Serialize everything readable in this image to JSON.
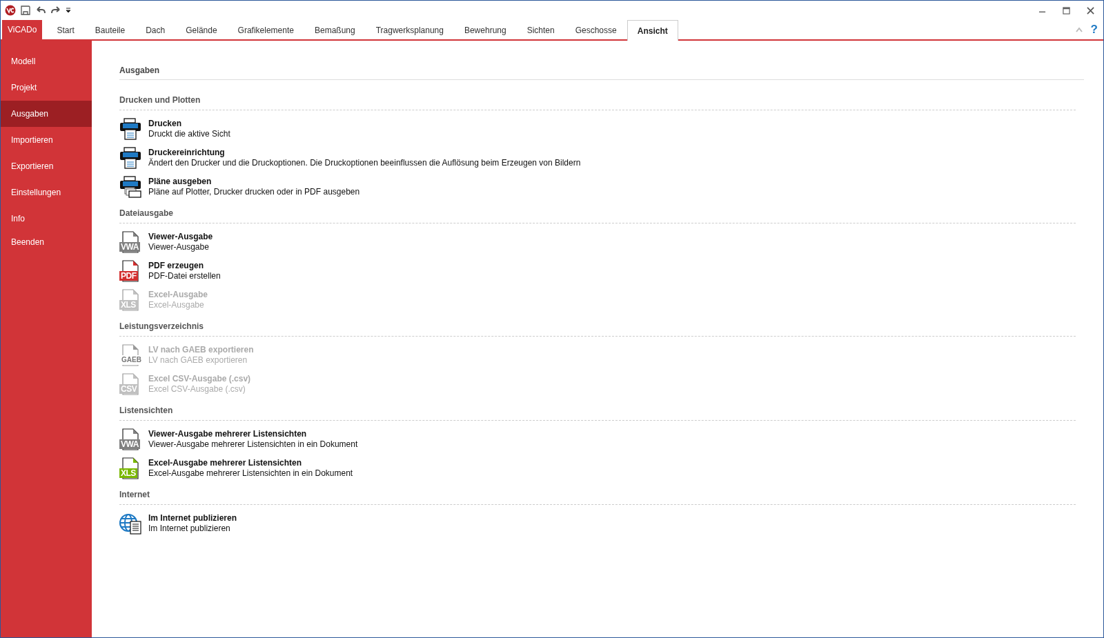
{
  "tabs": [
    {
      "label": "ViCADo",
      "kind": "app",
      "selected": false
    },
    {
      "label": "Start",
      "kind": "tab",
      "selected": false
    },
    {
      "label": "Bauteile",
      "kind": "tab",
      "selected": false
    },
    {
      "label": "Dach",
      "kind": "tab",
      "selected": false
    },
    {
      "label": "Gelände",
      "kind": "tab",
      "selected": false
    },
    {
      "label": "Grafikelemente",
      "kind": "tab",
      "selected": false
    },
    {
      "label": "Bemaßung",
      "kind": "tab",
      "selected": false
    },
    {
      "label": "Tragwerksplanung",
      "kind": "tab",
      "selected": false
    },
    {
      "label": "Bewehrung",
      "kind": "tab",
      "selected": false
    },
    {
      "label": "Sichten",
      "kind": "tab",
      "selected": false
    },
    {
      "label": "Geschosse",
      "kind": "tab",
      "selected": false
    },
    {
      "label": "Ansicht",
      "kind": "tab",
      "selected": true
    }
  ],
  "help": "?",
  "sidebar": {
    "items": [
      {
        "label": "Modell",
        "selected": false
      },
      {
        "label": "Projekt",
        "selected": false
      },
      {
        "label": "Ausgaben",
        "selected": true
      },
      {
        "label": "Importieren",
        "selected": false
      },
      {
        "label": "Exportieren",
        "selected": false
      },
      {
        "label": "Einstellungen",
        "selected": false
      },
      {
        "label": "Info",
        "selected": false
      },
      {
        "label": "Beenden",
        "selected": false
      }
    ]
  },
  "title": "Ausgaben",
  "sections": [
    {
      "heading": "Drucken und Plotten",
      "items": [
        {
          "kind": "printer",
          "title": "Drucken",
          "description": "Druckt die aktive Sicht",
          "disabled": false
        },
        {
          "kind": "printer",
          "title": "Druckereinrichtung",
          "description": "Ändert den Drucker und die Druckoptionen. Die Druckoptionen beeinflussen die Auflösung beim Erzeugen von Bildern",
          "disabled": false
        },
        {
          "kind": "printer-stack",
          "title": "Pläne ausgeben",
          "description": "Pläne auf Plotter, Drucker drucken oder in PDF ausgeben",
          "disabled": false
        }
      ]
    },
    {
      "heading": "Dateiausgabe",
      "items": [
        {
          "kind": "file",
          "badge": "VWA",
          "color": "#808080",
          "title": "Viewer-Ausgabe",
          "description": "Viewer-Ausgabe",
          "disabled": false
        },
        {
          "kind": "file",
          "badge": "PDF",
          "color": "#d32f2f",
          "title": "PDF erzeugen",
          "description": "PDF-Datei erstellen",
          "disabled": false
        },
        {
          "kind": "file",
          "badge": "XLS",
          "color": "#c0c0c0",
          "title": "Excel-Ausgabe",
          "description": "Excel-Ausgabe",
          "disabled": true
        }
      ]
    },
    {
      "heading": "Leistungsverzeichnis",
      "items": [
        {
          "kind": "file-text",
          "badge": "GAEB",
          "title": "LV nach GAEB exportieren",
          "description": "LV nach GAEB exportieren",
          "disabled": true
        },
        {
          "kind": "file",
          "badge": "CSV",
          "color": "#c0c0c0",
          "title": "Excel CSV-Ausgabe (.csv)",
          "description": "Excel CSV-Ausgabe (.csv)",
          "disabled": true
        }
      ]
    },
    {
      "heading": "Listensichten",
      "items": [
        {
          "kind": "file",
          "badge": "VWA",
          "color": "#808080",
          "title": "Viewer-Ausgabe mehrerer Listensichten",
          "description": "Viewer-Ausgabe mehrerer Listensichten in ein Dokument",
          "disabled": false
        },
        {
          "kind": "file",
          "badge": "XLS",
          "color": "#7ab800",
          "title": "Excel-Ausgabe mehrerer Listensichten",
          "description": "Excel-Ausgabe mehrerer Listensichten in ein Dokument",
          "disabled": false
        }
      ]
    },
    {
      "heading": "Internet",
      "items": [
        {
          "kind": "globe",
          "title": "Im Internet publizieren",
          "description": "Im Internet publizieren",
          "disabled": false
        }
      ]
    }
  ]
}
